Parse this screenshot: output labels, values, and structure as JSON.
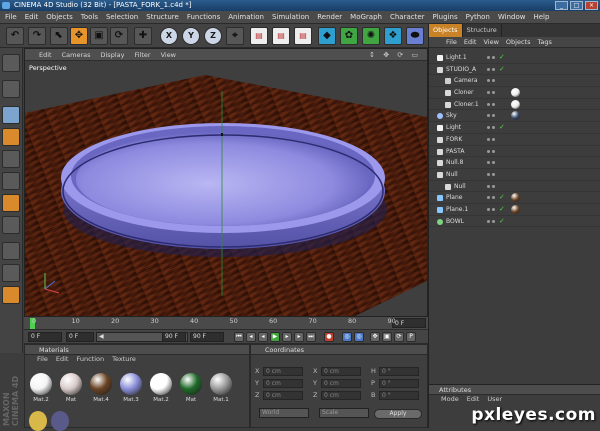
{
  "window": {
    "title": "CINEMA 4D Studio (32 Bit) - [PASTA_FORK_1.c4d *]"
  },
  "menubar": [
    "File",
    "Edit",
    "Objects",
    "Tools",
    "Selection",
    "Structure",
    "Functions",
    "Animation",
    "Simulation",
    "Render",
    "MoGraph",
    "Character",
    "Plugins",
    "Python",
    "Window",
    "Help"
  ],
  "viewport": {
    "menu": [
      "Edit",
      "Cameras",
      "Display",
      "Filter",
      "View"
    ],
    "label": "Perspective",
    "nav": "↕ ✥ ⟳ ▭"
  },
  "toolbar": {
    "xyz": [
      "X",
      "Y",
      "Z"
    ]
  },
  "timeline": {
    "ticks": [
      "0",
      "10",
      "20",
      "30",
      "40",
      "50",
      "60",
      "70",
      "80",
      "90"
    ],
    "end_frame": "0 F"
  },
  "transport": {
    "current": "0 F",
    "start": "0 F",
    "scrub": "90 F",
    "end": "90 F"
  },
  "materials": {
    "title": "Materials",
    "menu": [
      "File",
      "Edit",
      "Function",
      "Texture"
    ],
    "items": [
      {
        "name": "Mat.2",
        "color": "#f4f4f4"
      },
      {
        "name": "Mat",
        "color": "#d8cbc9"
      },
      {
        "name": "Mat.4",
        "color": "#6a4324"
      },
      {
        "name": "Mat.3",
        "color": "#8b8fd9"
      },
      {
        "name": "Mat.2",
        "color": "#ffffff"
      },
      {
        "name": "Mat",
        "color": "#1f6a2a"
      },
      {
        "name": "Mat.1",
        "color": "#9a9a9a"
      }
    ]
  },
  "coordinates": {
    "title": "Coordinates",
    "rows": [
      {
        "a": "X",
        "v1": "0 cm",
        "b": "X",
        "v2": "0 cm",
        "c": "H",
        "v3": "0 °"
      },
      {
        "a": "Y",
        "v1": "0 cm",
        "b": "Y",
        "v2": "0 cm",
        "c": "P",
        "v3": "0 °"
      },
      {
        "a": "Z",
        "v1": "0 cm",
        "b": "Z",
        "v2": "0 cm",
        "c": "B",
        "v3": "0 °"
      }
    ],
    "mode1": "World",
    "mode2": "Scale",
    "apply": "Apply"
  },
  "objects": {
    "tabs": [
      "Objects",
      "Structure"
    ],
    "menu": [
      "File",
      "Edit",
      "View",
      "Objects",
      "Tags"
    ],
    "rows": [
      {
        "name": "Light.1",
        "indent": 0,
        "icon": "light",
        "color": "#dddddd",
        "check": true,
        "tags": []
      },
      {
        "name": "STUDIO_A",
        "indent": 0,
        "icon": "null",
        "color": "#dddddd",
        "check": true,
        "tags": []
      },
      {
        "name": "Camera",
        "indent": 1,
        "icon": "camera",
        "color": "#dddddd",
        "check": false,
        "tags": []
      },
      {
        "name": "Cloner",
        "indent": 1,
        "icon": "null",
        "color": "#dddddd",
        "check": false,
        "tags": [
          "#eeeeee"
        ]
      },
      {
        "name": "Cloner.1",
        "indent": 1,
        "icon": "null",
        "color": "#dddddd",
        "check": false,
        "tags": [
          "#eeeeee"
        ]
      },
      {
        "name": "Sky",
        "indent": 0,
        "icon": "sky",
        "color": "#dddddd",
        "check": false,
        "tags": [
          "#3a4a6a"
        ]
      },
      {
        "name": "Light",
        "indent": 0,
        "icon": "light",
        "color": "#dddddd",
        "check": true,
        "tags": []
      },
      {
        "name": "FORK",
        "indent": 0,
        "icon": "null",
        "color": "#dddddd",
        "check": false,
        "tags": []
      },
      {
        "name": "PASTA",
        "indent": 0,
        "icon": "null",
        "color": "#dddddd",
        "check": false,
        "tags": []
      },
      {
        "name": "Null.8",
        "indent": 0,
        "icon": "null",
        "color": "#dddddd",
        "check": false,
        "tags": []
      },
      {
        "name": "Null",
        "indent": 0,
        "icon": "null",
        "color": "#dddddd",
        "check": false,
        "tags": []
      },
      {
        "name": "Null",
        "indent": 1,
        "icon": "null",
        "color": "#dddddd",
        "check": false,
        "tags": []
      },
      {
        "name": "Plane",
        "indent": 0,
        "icon": "plane",
        "color": "#dddddd",
        "check": true,
        "tags": [
          "#6a4324"
        ]
      },
      {
        "name": "Plane.1",
        "indent": 0,
        "icon": "plane",
        "color": "#dddddd",
        "check": true,
        "tags": [
          "#6a4324"
        ]
      },
      {
        "name": "BOWL",
        "indent": 0,
        "icon": "bowl",
        "color": "#dddddd",
        "check": true,
        "tags": []
      }
    ]
  },
  "attributes": {
    "title": "Attributes",
    "menu": [
      "Mode",
      "Edit",
      "User"
    ]
  },
  "watermark": "pxleyes.com",
  "brand": "MAXON CINEMA 4D"
}
